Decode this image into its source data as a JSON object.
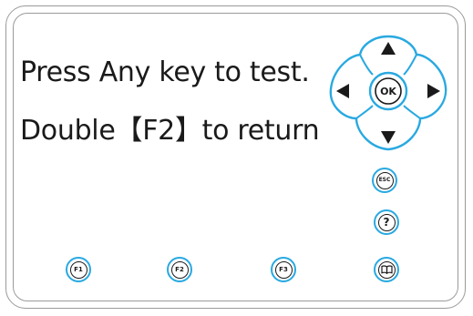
{
  "screen": {
    "line1": "Press Any key to test.",
    "line2": "Double【F2】to return"
  },
  "keys": {
    "ok": "OK",
    "esc": "ESC",
    "help": "?",
    "f1": "F1",
    "f2": "F2",
    "f3": "F3",
    "up_icon": "arrow-up-icon",
    "down_icon": "arrow-down-icon",
    "left_icon": "arrow-left-icon",
    "right_icon": "arrow-right-icon",
    "book_icon": "book-icon"
  },
  "colors": {
    "key_outline": "#29a9e1",
    "text": "#1a1a1a",
    "frame": "#9a9a9a"
  }
}
